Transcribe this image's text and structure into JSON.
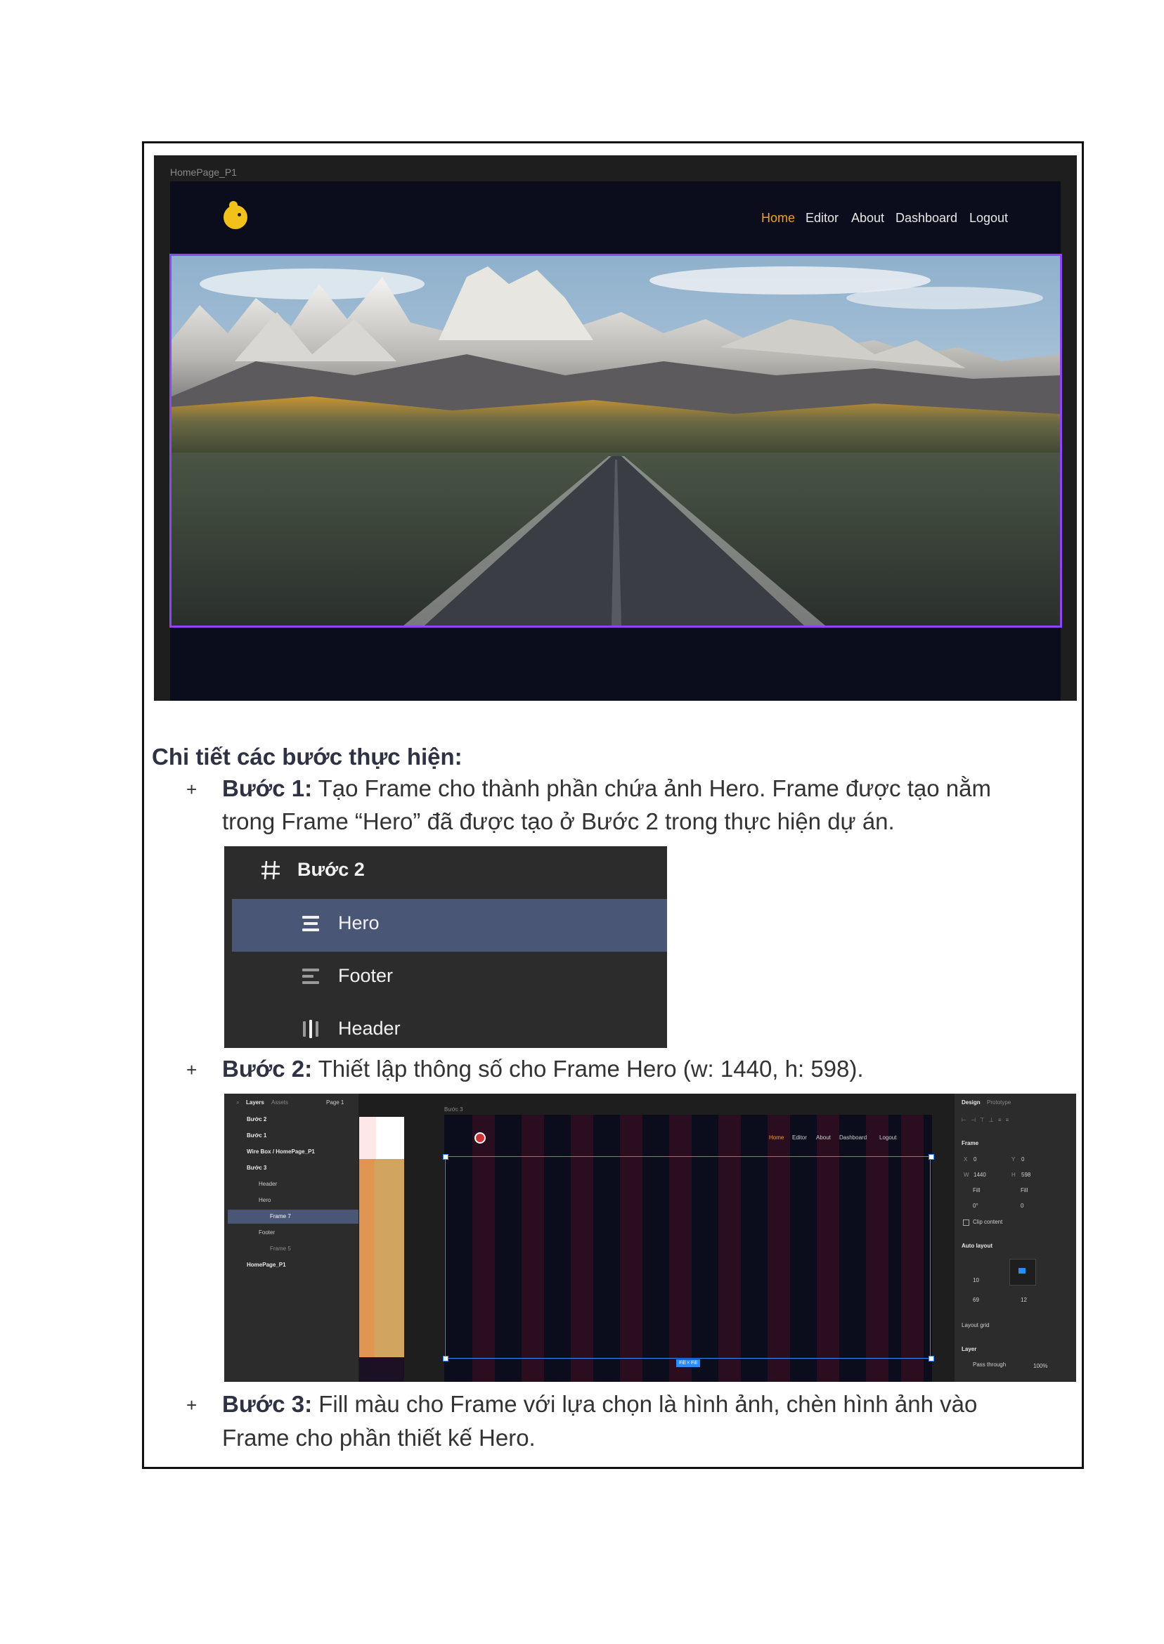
{
  "figure1": {
    "frame_label": "HomePage_P1",
    "nav": [
      "Home",
      "Editor",
      "About",
      "Dashboard",
      "Logout"
    ]
  },
  "section": {
    "heading": "Chi tiết các bước thực hiện:",
    "bullet": "+",
    "step1": {
      "title": "Bước 1:",
      "line1": "Tạo Frame cho thành phần chứa ảnh Hero. Frame được tạo nằm",
      "line2": "trong Frame “Hero” đã được tạo ở Bước 2 trong thực hiện dự án."
    },
    "step2": {
      "title": "Bước 2:",
      "text": "Thiết lập thông số cho Frame Hero (w: 1440, h: 598)."
    },
    "step3": {
      "title": "Bước 3:",
      "line1": "Fill màu cho Frame với lựa chọn là hình ảnh, chèn hình ảnh vào",
      "line2": "Frame cho phần thiết kế Hero."
    }
  },
  "layers_panel": {
    "root": "Bước 2",
    "items": [
      "Hero",
      "Footer",
      "Header"
    ]
  },
  "figma": {
    "tabs": [
      "Layers",
      "Assets"
    ],
    "page": "Page 1",
    "layers": [
      "Bước 2",
      "Bước 1",
      "Wire Box / HomePage_P1",
      "Bước 3",
      "Header",
      "Hero",
      "Frame 7",
      "Footer",
      "Frame 5",
      "HomePage_P1"
    ],
    "canvas_label": "Bước 3",
    "nav": [
      "Home",
      "Editor",
      "About",
      "Dashboard",
      "Logout"
    ],
    "badge": "Fill × Fill",
    "right_tabs": [
      "Design",
      "Prototype"
    ],
    "frame_title": "Frame",
    "props": {
      "x_label": "X",
      "x": "0",
      "y_label": "Y",
      "y": "0",
      "w_label": "W",
      "w": "1440",
      "h_label": "H",
      "h": "598",
      "fill1": "Fill",
      "fill2": "Fill",
      "rot": "0°",
      "radius": "0",
      "clip": "Clip content",
      "auto_layout": "Auto layout",
      "gap": "10",
      "pad": "69",
      "pad2": "12",
      "layout_grid": "Layout grid",
      "layer": "Layer",
      "blend": "Pass through",
      "opacity": "100%"
    }
  }
}
